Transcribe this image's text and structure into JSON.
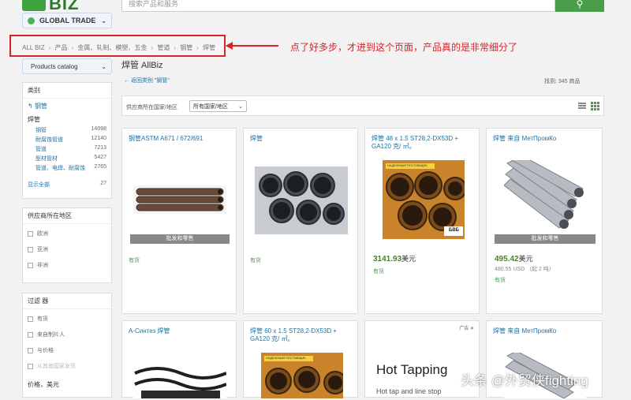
{
  "header": {
    "logo_text": "BIZ",
    "global_trade": "GLOBAL TRADE",
    "search_placeholder": "搜索产品和服务"
  },
  "breadcrumb": [
    "ALL BIZ",
    "产品",
    "金属、轧制、模塑、五金",
    "管道",
    "钢管",
    "焊管"
  ],
  "annotation": "点了好多步，才进到这个页面，产品真的是非常细分了",
  "sidebar": {
    "catalog_button": "Products catalog",
    "category_header": "类别",
    "back_item": "钢管",
    "current": "焊管",
    "categories": [
      {
        "name": "钢管",
        "count": "14098"
      },
      {
        "name": "耐腐蚀管道",
        "count": "12140"
      },
      {
        "name": "管道",
        "count": "7213"
      },
      {
        "name": "型材管材",
        "count": "5427"
      },
      {
        "name": "管道、电焊、耐腐蚀",
        "count": "2765"
      }
    ],
    "show_all": "显示全部",
    "show_all_count": "27",
    "region_header": "供应商所在地区",
    "regions": [
      "欧洲",
      "亚洲",
      "非洲"
    ],
    "filter_header": "过滤 器",
    "filters": [
      "有货",
      "来自制片人",
      "与价格",
      "从其他国家发货"
    ],
    "price_label": "价格，美元"
  },
  "main": {
    "title": "焊管 AllBiz",
    "back_link": "← 返回类别 \"钢管\"",
    "found": "找到:   345 商品",
    "supplier_label": "供应商所在国家/地区",
    "country_select": "所有国家/地区"
  },
  "products": [
    {
      "title": "钢管ASTM A671 / 672/691",
      "bar": "批发和零售",
      "stock": "有货"
    },
    {
      "title": "焊管",
      "stock": "有货"
    },
    {
      "title": "焊管 48 x 1.5 ST28,2-DX53D + GA120 克/ ㎡。",
      "price": "3141.93",
      "unit": "美元",
      "stock": "有货",
      "img_label": "НАДЕЖНЫЙ ПОСТАВЩИК",
      "img_brand": "БВБ"
    },
    {
      "title": "焊管 来自 МетПромКо",
      "bar": "批发和零售",
      "price": "495.42",
      "unit": "美元",
      "sub_price": "480.55 USD （起 2 吨）",
      "stock": "有货"
    },
    {
      "title": "А-Синтез 焊管"
    },
    {
      "title": "焊管 60 x 1.5 ST28,2-DX53D + GA120 克/ ㎡。",
      "img_label": "НАДЕЖНЫЙ ПОСТАВЩИК"
    },
    {
      "ad_label": "广告 ✕",
      "ad_title": "Hot Tapping",
      "ad_sub": "Hot tap and line stop"
    },
    {
      "title": "焊管 来自 МетПромКо"
    }
  ],
  "watermark": "头条 @外贸侠fighting"
}
